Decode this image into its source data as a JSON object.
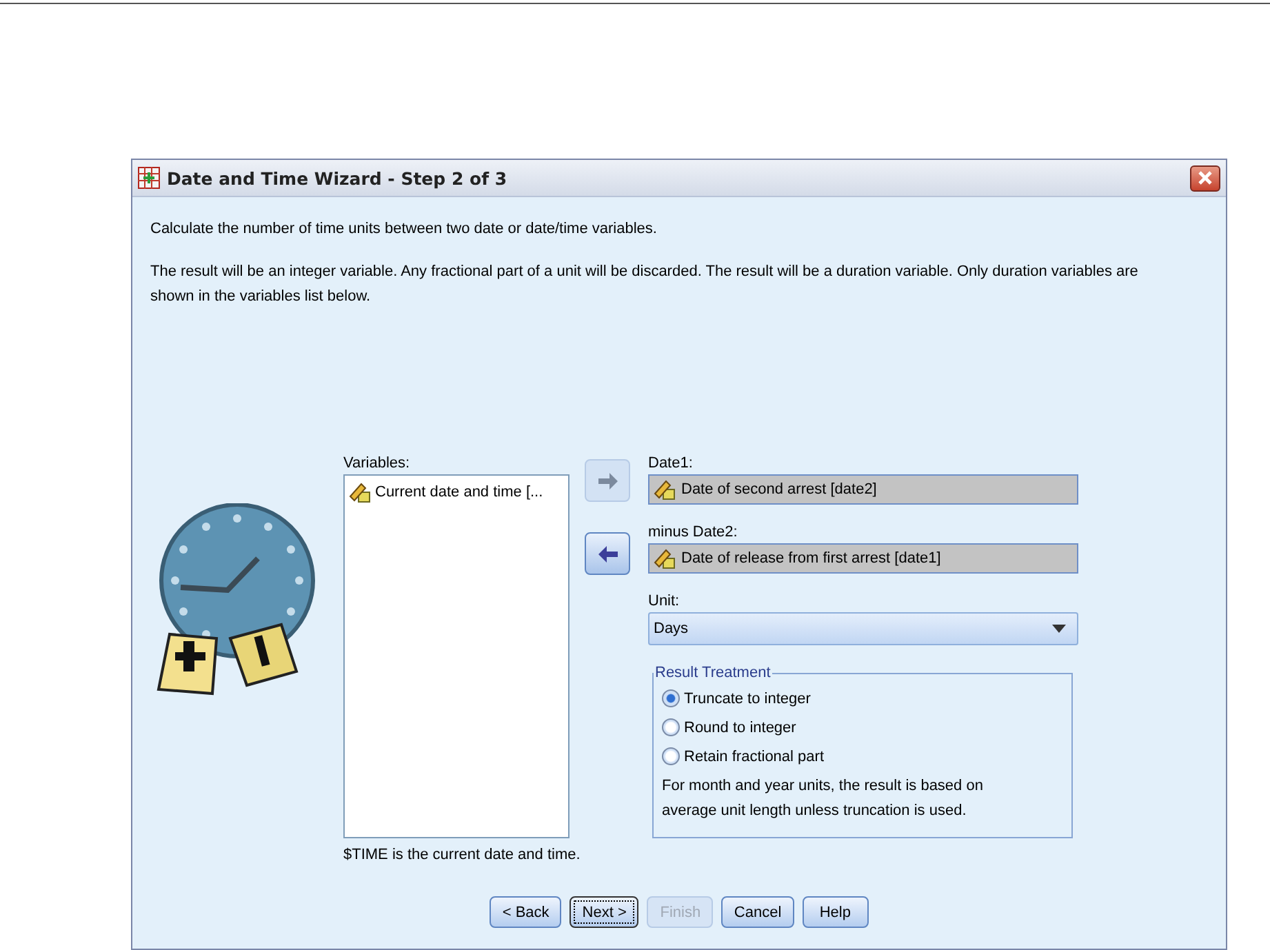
{
  "window": {
    "title": "Date and Time Wizard - Step 2 of 3"
  },
  "intro": [
    "Calculate the number of time units between two date or date/time variables.",
    "The result will be an integer variable. Any fractional part of a unit will be discarded. The result will be a duration variable. Only duration variables are shown in the variables list below."
  ],
  "variables": {
    "label": "Variables:",
    "items": [
      "Current date and time [..."
    ],
    "note": "$TIME is the current date and time."
  },
  "move_buttons": [
    {
      "disabled": true,
      "kind": "right"
    },
    {
      "disabled": false,
      "kind": "left"
    }
  ],
  "date1": {
    "label": "Date1:",
    "value": "Date of second arrest [date2]"
  },
  "date2": {
    "label": "minus Date2:",
    "value": "Date of release from first arrest [date1]"
  },
  "unit": {
    "label": "Unit:",
    "value": "Days"
  },
  "result_treatment": {
    "title": "Result Treatment",
    "options": [
      {
        "label": "Truncate to integer",
        "selected": true
      },
      {
        "label": "Round to integer",
        "selected": false
      },
      {
        "label": "Retain fractional part",
        "selected": false
      }
    ],
    "note": "For month and year units, the result is based on average unit length unless truncation is used."
  },
  "buttons": [
    {
      "label": "< Back",
      "disabled": false,
      "default": false
    },
    {
      "label": "Next >",
      "disabled": false,
      "default": true
    },
    {
      "label": "Finish",
      "disabled": true,
      "default": false
    },
    {
      "label": "Cancel",
      "disabled": false,
      "default": false
    },
    {
      "label": "Help",
      "disabled": false,
      "default": false
    }
  ]
}
